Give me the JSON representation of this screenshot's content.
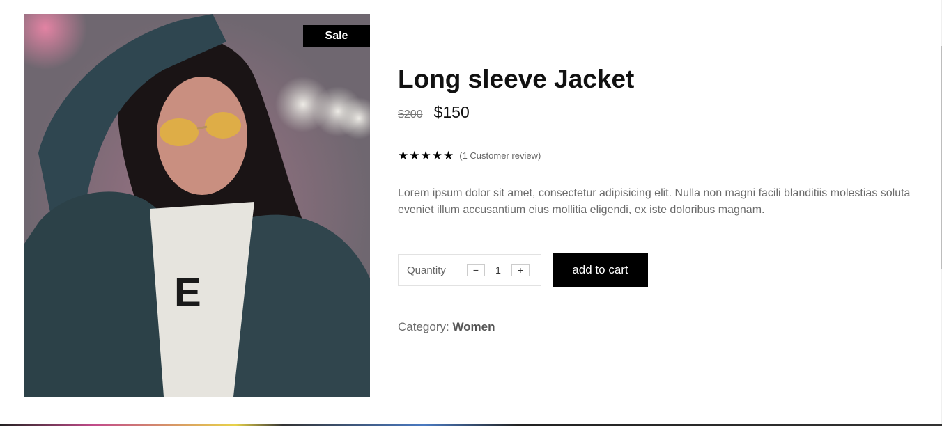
{
  "product": {
    "badge": "Sale",
    "title": "Long sleeve Jacket",
    "old_price": "$200",
    "new_price": "$150",
    "rating": 5,
    "review_text": "(1 Customer review)",
    "description": "Lorem ipsum dolor sit amet, consectetur adipisicing elit. Nulla non magni facili blanditiis molestias soluta eveniet illum accusantium eius mollitia eligendi, ex iste doloribus magnam.",
    "image_icon": "product-photo"
  },
  "cart": {
    "quantity_label": "Quantity",
    "decrement_label": "−",
    "quantity_value": "1",
    "increment_label": "+",
    "add_to_cart_label": "add to cart"
  },
  "category": {
    "label": "Category:",
    "value": "Women"
  },
  "colors": {
    "primary": "#000000",
    "text_muted": "#6b6b6b"
  }
}
